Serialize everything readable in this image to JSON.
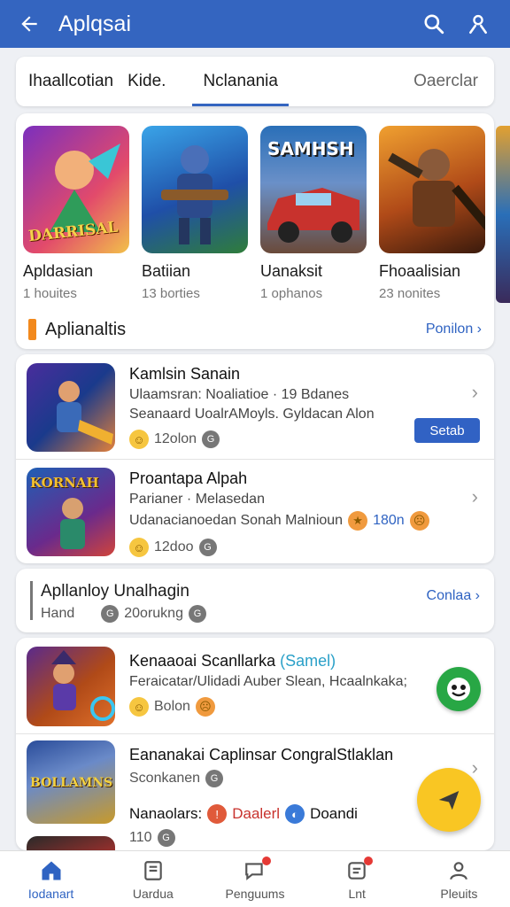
{
  "appbar": {
    "title": "Aplqsai",
    "back_icon": "arrow-left-icon",
    "search_icon": "search-icon",
    "profile_icon": "profile-icon"
  },
  "tabs": [
    {
      "label": "Ihaallcotian"
    },
    {
      "label": "Kide."
    },
    {
      "label": "Nclanania",
      "active": true
    },
    {
      "label": "Oaerclar"
    }
  ],
  "featured": [
    {
      "name": "Apldasian",
      "sub": "1 houites",
      "art_text": "DARRISAL",
      "colors": [
        "#7b2fbe",
        "#e24a6b"
      ]
    },
    {
      "name": "Batiian",
      "sub": "13 borties",
      "art_text": "",
      "colors": [
        "#1f4fa8",
        "#3aa4e8"
      ]
    },
    {
      "name": "Uanaksit",
      "sub": "1 ophanos",
      "art_text": "SAMHSH",
      "colors": [
        "#2a6fb8",
        "#c8322d"
      ]
    },
    {
      "name": "Fhoaalisian",
      "sub": "23 nonites",
      "art_text": "",
      "colors": [
        "#e07a1a",
        "#6a2a10"
      ]
    }
  ],
  "section": {
    "title": "Aplianaltis",
    "link": "Ponilon ›"
  },
  "list1": [
    {
      "title": "Kamlsin Sanain",
      "line1": "Ulaamsran: Noaliatioe · 19 Bdanes",
      "line2": "Seanaard UoalrAMoyls. Gyldacan Alon",
      "meta": "12olon",
      "button": "Setab",
      "colors": [
        "#4a2d9c",
        "#e2803a"
      ]
    },
    {
      "title": "Proantapa Alpah",
      "line1": "Parianer · Melasedan",
      "line2": "Udanacianoedan Sonah Malnioun",
      "meta": "12doo",
      "extra": "180n",
      "art_text": "KORNAH",
      "colors": [
        "#1f5fb5",
        "#d0443b"
      ]
    }
  ],
  "banner": {
    "title": "Apllanloy Unalhagin",
    "sub1": "Hand",
    "sub2": "20orukng",
    "link": "Conlaa ›"
  },
  "list2": [
    {
      "title": "Kenaaoai Scanllarka",
      "title_suffix": "(Samel)",
      "line1": "Feraicatar/Ulidadi Auber Slean, Hcaalnkaka;",
      "meta": "Bolon",
      "colors": [
        "#5a2a8c",
        "#e0702a"
      ]
    },
    {
      "title": "Eananakai Caplinsar CongralStlaklan",
      "line1": "Sconkanen",
      "art_text": "BOLLAMNS",
      "colors": [
        "#2a4c9a",
        "#c89a2a"
      ]
    }
  ],
  "last_row": {
    "title_prefix": "Nanaolars:",
    "link1": "Daalerl",
    "link2": "Doandi",
    "count": "110"
  },
  "bottom_nav": [
    {
      "label": "Iodanart",
      "icon": "home-icon",
      "active": true
    },
    {
      "label": "Uardua",
      "icon": "library-icon"
    },
    {
      "label": "Penguums",
      "icon": "chat-icon"
    },
    {
      "label": "Lnt",
      "icon": "list-icon"
    },
    {
      "label": "Pleuits",
      "icon": "person-icon"
    }
  ],
  "colors": {
    "primary": "#3465c0",
    "accent": "#f2891d",
    "fab_green": "#28a745",
    "fab_yellow": "#f9c623"
  }
}
